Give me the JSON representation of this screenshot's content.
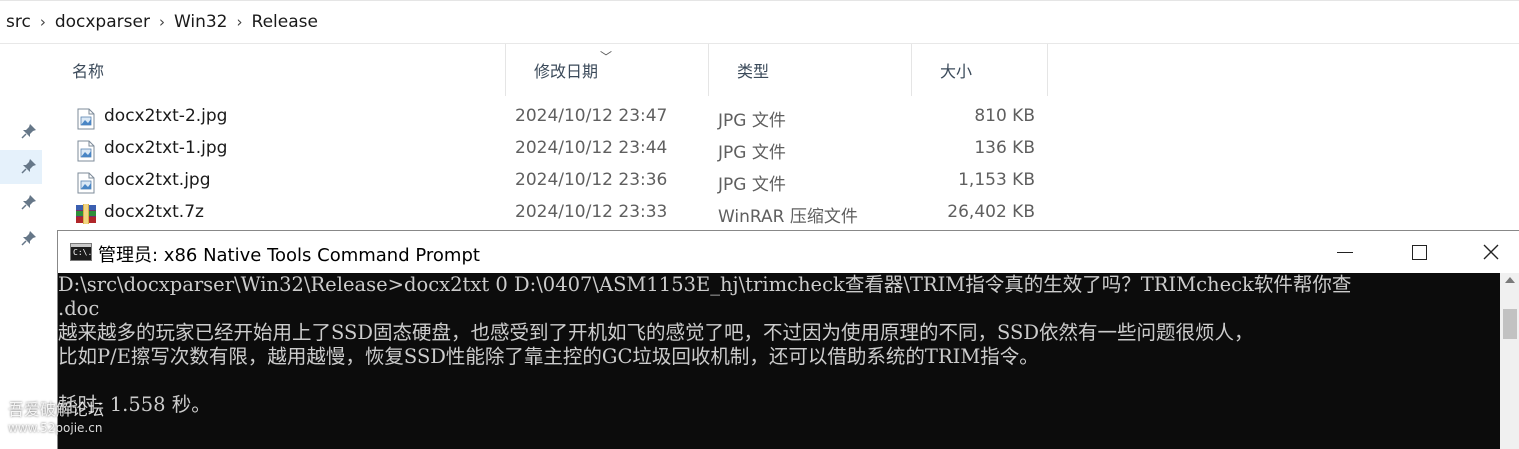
{
  "breadcrumb": [
    "src",
    "docxparser",
    "Win32",
    "Release"
  ],
  "columns": {
    "name": "名称",
    "date": "修改日期",
    "type": "类型",
    "size": "大小"
  },
  "files": [
    {
      "name": "docx2txt-2.jpg",
      "date": "2024/10/12 23:47",
      "type": "JPG 文件",
      "size": "810 KB",
      "icon": "image-file-icon"
    },
    {
      "name": "docx2txt-1.jpg",
      "date": "2024/10/12 23:44",
      "type": "JPG 文件",
      "size": "136 KB",
      "icon": "image-file-icon"
    },
    {
      "name": "docx2txt.jpg",
      "date": "2024/10/12 23:36",
      "type": "JPG 文件",
      "size": "1,153 KB",
      "icon": "image-file-icon"
    },
    {
      "name": "docx2txt.7z",
      "date": "2024/10/12 23:33",
      "type": "WinRAR 压缩文件",
      "size": "26,402 KB",
      "icon": "winrar-archive-icon"
    }
  ],
  "console": {
    "title": "管理员: x86 Native Tools Command Prompt",
    "lines": [
      "D:\\src\\docxparser\\Win32\\Release>docx2txt 0 D:\\0407\\ASM1153E_hj\\trimcheck查看器\\TRIM指令真的生效了吗？TRIMcheck软件帮你查",
      ".doc",
      "越来越多的玩家已经开始用上了SSD固态硬盘，也感受到了开机如飞的感觉了吧，不过因为使用原理的不同，SSD依然有一些问题很烦人，",
      "比如P/E擦写次数有限，越用越慢，恢复SSD性能除了靠主控的GC垃圾回收机制，还可以借助系统的TRIM指令。",
      "",
      "耗时: 1.558 秒。"
    ],
    "icon_text": "C:\\."
  },
  "watermark": {
    "name": "吾爱破解论坛",
    "url": "www.52pojie.cn"
  }
}
